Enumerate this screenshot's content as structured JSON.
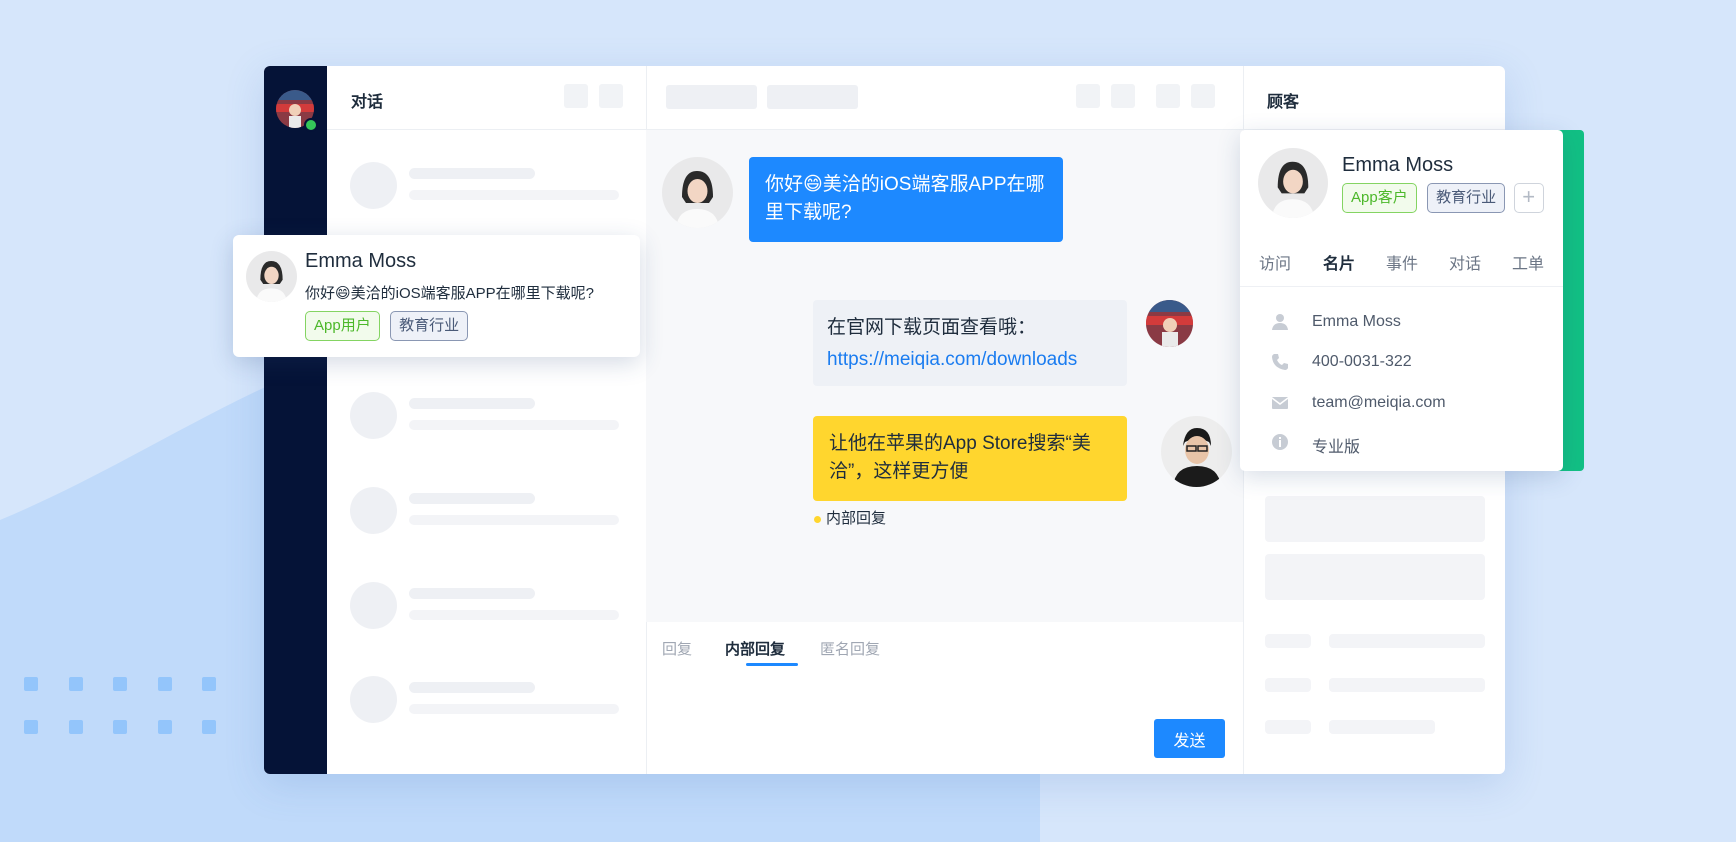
{
  "conversation_list": {
    "title": "对话"
  },
  "chat": {
    "messages": [
      {
        "text": "你好😄美洽的iOS端客服APP在哪里下载呢?"
      },
      {
        "line1": "在官网下载页面查看哦：",
        "link": "https://meiqia.com/downloads"
      },
      {
        "text": "让他在苹果的App Store搜索“美洽”，这样更方便",
        "note": "内部回复"
      }
    ],
    "reply_tabs": [
      "回复",
      "内部回复",
      "匿名回复"
    ],
    "send_label": "发送"
  },
  "notification": {
    "name": "Emma Moss",
    "message": "你好😄美洽的iOS端客服APP在哪里下载呢?",
    "tags": [
      "App用户",
      "教育行业"
    ]
  },
  "customer_panel": {
    "title": "顾客",
    "name": "Emma Moss",
    "tags": [
      "App客户",
      "教育行业"
    ],
    "add_tag_symbol": "+",
    "tabs": [
      "访问",
      "名片",
      "事件",
      "对话",
      "工单"
    ],
    "info": [
      {
        "icon": "person-icon",
        "value": "Emma Moss"
      },
      {
        "icon": "phone-icon",
        "value": "400-0031-322"
      },
      {
        "icon": "mail-icon",
        "value": "team@meiqia.com"
      },
      {
        "icon": "info-icon",
        "value": "专业版"
      }
    ]
  },
  "colors": {
    "brand_blue": "#1d89ff",
    "rail_navy": "#051337",
    "accent_green": "#12c084",
    "internal_yellow": "#ffd62e"
  }
}
